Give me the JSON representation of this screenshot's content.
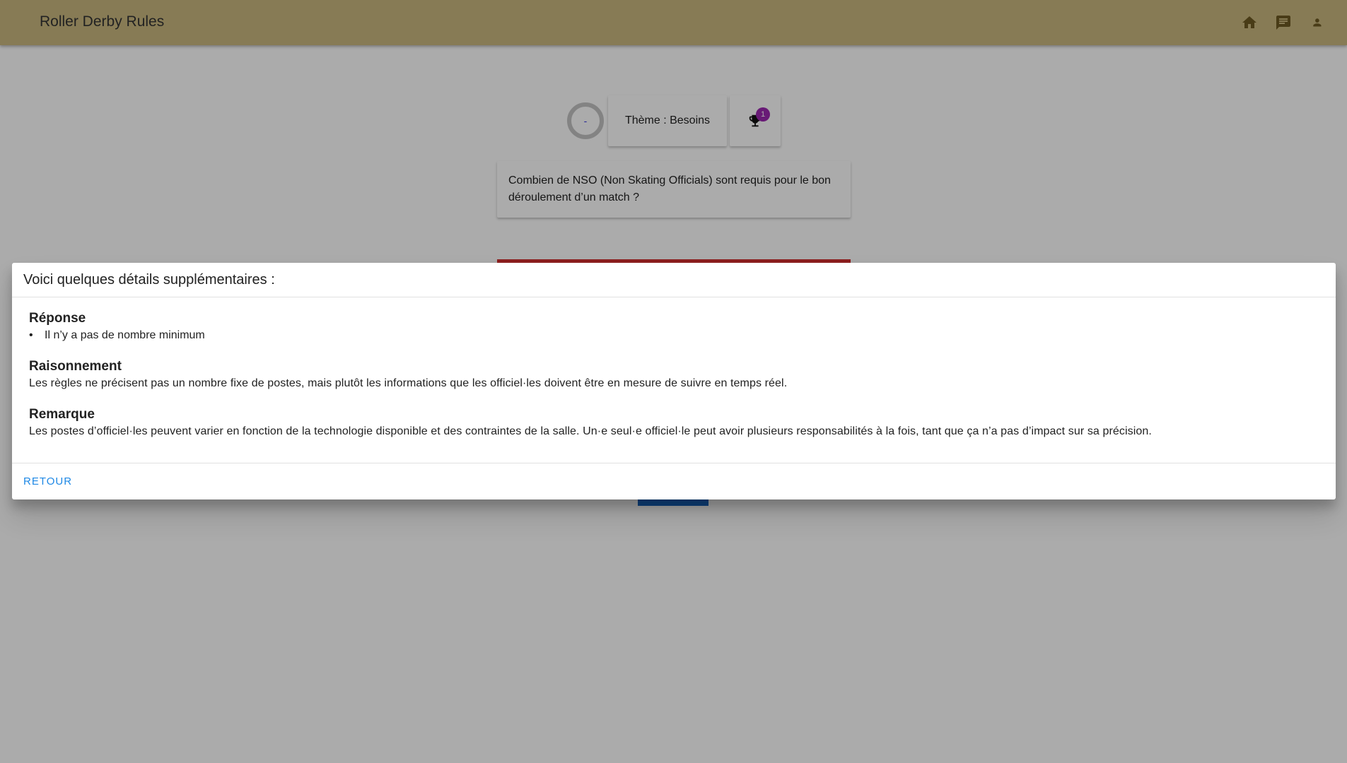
{
  "appbar": {
    "title": "Roller Derby Rules",
    "icons": [
      "home-icon",
      "message-icon",
      "account-icon"
    ]
  },
  "quiz": {
    "timer": "-",
    "theme": "Thème : Besoins",
    "trophy_badge": "1",
    "question": "Combien de NSO (Non Skating Officials) sont requis pour le bon déroulement d’un match ?"
  },
  "dialog": {
    "title": "Voici quelques détails supplémentaires :",
    "sections": [
      {
        "heading": "Réponse",
        "items": [
          "Il n’y a pas de nombre minimum"
        ]
      },
      {
        "heading": "Raisonnement",
        "text": "Les règles ne précisent pas un nombre fixe de postes, mais plutôt les informations que les officiel·les doivent être en mesure de suivre en temps réel."
      },
      {
        "heading": "Remarque",
        "text": "Les postes d’officiel·les peuvent varier en fonction de la technologie disponible et des contraintes de la salle. Un·e seul·e officiel·le peut avoir plusieurs responsabilités à la fois, tant que ça n’a pas d’impact sur sa précision."
      }
    ],
    "back_label": "RETOUR"
  },
  "colors": {
    "appbar": "#c9b87f",
    "badge": "#9c27b0",
    "answer_bar": "#d32f2f",
    "link": "#1e88e5"
  }
}
